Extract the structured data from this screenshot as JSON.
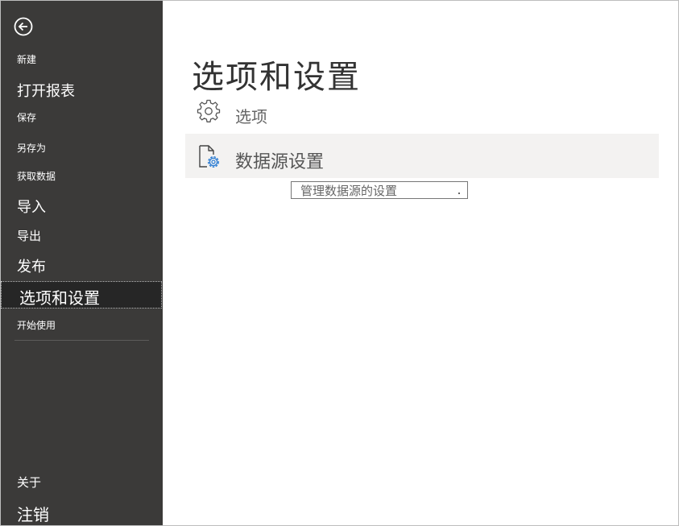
{
  "sidebar": {
    "back_label": "",
    "items": [
      {
        "label": "新建"
      },
      {
        "label": "打开报表"
      },
      {
        "label": "保存"
      },
      {
        "label": "另存为"
      },
      {
        "label": "获取数据"
      },
      {
        "label": "导入"
      },
      {
        "label": "导出"
      },
      {
        "label": "发布"
      },
      {
        "label": "选项和设置"
      },
      {
        "label": "开始使用"
      },
      {
        "label": "关于"
      },
      {
        "label": "注销"
      }
    ],
    "selected_index": 8
  },
  "main": {
    "title": "选项和设置",
    "options": [
      {
        "label": "选项",
        "icon": "gear-icon"
      },
      {
        "label": "数据源设置",
        "icon": "data-source-settings-icon"
      }
    ],
    "tooltip": "管理数据源的设置"
  },
  "colors": {
    "sidebar_bg": "#3b3a39",
    "sidebar_selected_bg": "#262626",
    "hover_row_bg": "#f3f2f1",
    "accent_blue": "#2b7cd3"
  }
}
